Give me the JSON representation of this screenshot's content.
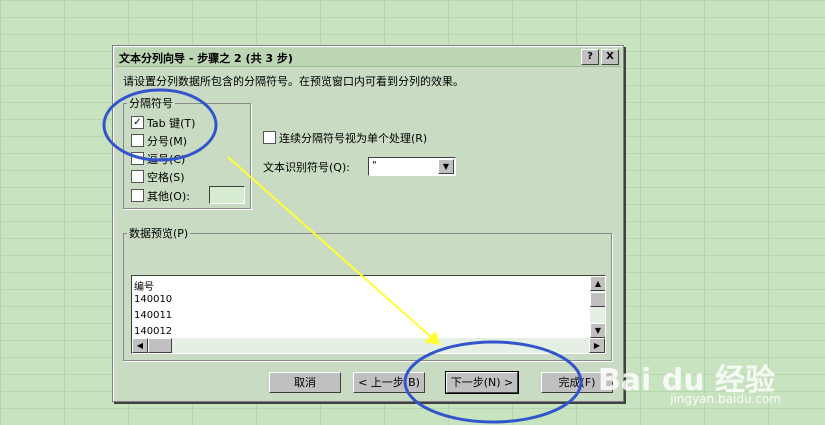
{
  "dialog": {
    "title": "文本分列向导 - 步骤之 2 (共 3 步)",
    "help_label": "?",
    "close_label": "X",
    "instruction": "请设置分列数据所包含的分隔符号。在预览窗口内可看到分列的效果。"
  },
  "delimiters": {
    "group_label": "分隔符号",
    "tab": {
      "label": "Tab 键(T)",
      "checked": true
    },
    "semicolon": {
      "label": "分号(M)",
      "checked": false
    },
    "comma": {
      "label": "逗号(C)",
      "checked": false
    },
    "space": {
      "label": "空格(S)",
      "checked": false
    },
    "other": {
      "label": "其他(O):",
      "checked": false,
      "value": ""
    }
  },
  "options": {
    "consecutive": {
      "label": "连续分隔符号视为单个处理(R)",
      "checked": false
    },
    "qualifier_label": "文本识别符号(Q):",
    "qualifier_value": "\""
  },
  "preview": {
    "group_label": "数据预览(P)",
    "rows": [
      "编号",
      "140010",
      "140011",
      "140012"
    ]
  },
  "buttons": {
    "cancel": "取消",
    "back": "< 上一步(B)",
    "next": "下一步(N) >",
    "finish": "完成(F)"
  },
  "watermark": {
    "logo": "Bai du 经验",
    "url": "jingyan.baidu.com"
  },
  "colors": {
    "annotation_circle": "#3355cc",
    "annotation_arrow": "#ffff33"
  },
  "icons": {
    "checked": "check-icon",
    "dropdown": "chevron-down-icon"
  }
}
